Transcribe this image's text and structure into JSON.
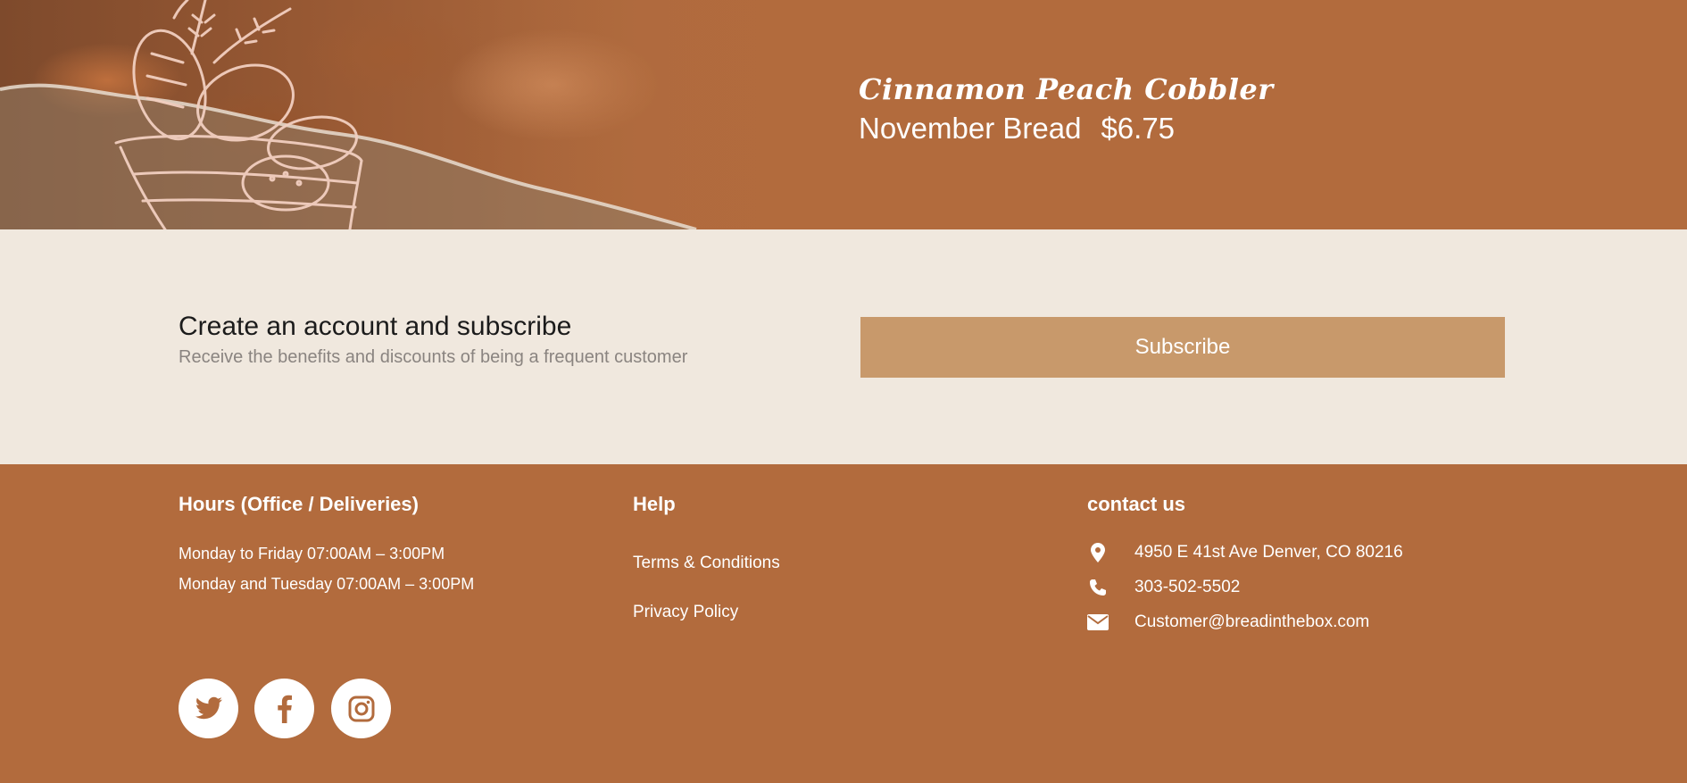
{
  "hero": {
    "script_title": "Cinnamon Peach Cobbler",
    "product_name": "November Bread",
    "price": "$6.75"
  },
  "subscribe": {
    "title": "Create an account and subscribe",
    "description": "Receive the benefits and discounts of being a frequent customer",
    "button_label": "Subscribe"
  },
  "footer": {
    "hours": {
      "title": "Hours (Office / Deliveries)",
      "lines": [
        "Monday to Friday 07:00AM – 3:00PM",
        "Monday and Tuesday 07:00AM – 3:00PM"
      ]
    },
    "help": {
      "title": "Help",
      "links": [
        "Terms & Conditions",
        "Privacy Policy"
      ]
    },
    "contact": {
      "title": "contact us",
      "address": "4950 E 41st Ave Denver, CO 80216",
      "phone": "303-502-5502",
      "email": "Customer@breadinthebox.com"
    },
    "social": [
      {
        "icon": "twitter-icon"
      },
      {
        "icon": "facebook-icon"
      },
      {
        "icon": "instagram-icon"
      }
    ]
  },
  "colors": {
    "brand_brown": "#b26b3d",
    "cream": "#f0e8de",
    "button_tan": "#c8996b"
  }
}
